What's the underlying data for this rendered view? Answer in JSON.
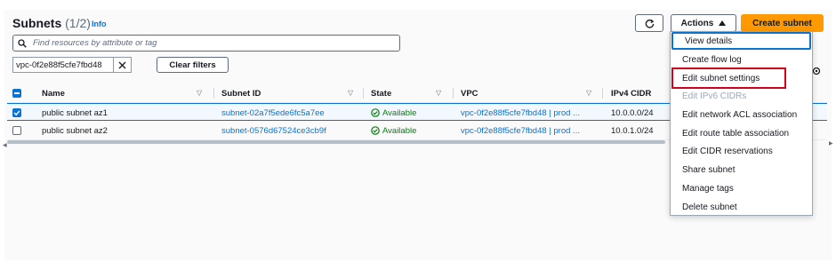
{
  "header": {
    "title": "Subnets",
    "count": "(1/2)",
    "info": "Info",
    "actions_label": "Actions",
    "create_label": "Create subnet"
  },
  "search": {
    "placeholder": "Find resources by attribute or tag",
    "value": ""
  },
  "filter": {
    "token": "vpc-0f2e88f5cfe7fbd48",
    "clear_label": "Clear filters"
  },
  "table": {
    "columns": [
      "Name",
      "Subnet ID",
      "State",
      "VPC",
      "IPv4 CIDR"
    ],
    "rows": [
      {
        "selected": true,
        "name": "public subnet az1",
        "subnet_id": "subnet-02a7f5ede6fc5a7ee",
        "state": "Available",
        "vpc": "vpc-0f2e88f5cfe7fbd48 | prod ...",
        "cidr": "10.0.0.0/24"
      },
      {
        "selected": false,
        "name": "public subnet az2",
        "subnet_id": "subnet-0576d67524ce3cb9f",
        "state": "Available",
        "vpc": "vpc-0f2e88f5cfe7fbd48 | prod ...",
        "cidr": "10.0.1.0/24"
      }
    ]
  },
  "menu": {
    "items": [
      {
        "label": "View details",
        "disabled": false,
        "focused": true
      },
      {
        "label": "Create flow log",
        "disabled": false
      },
      {
        "label": "Edit subnet settings",
        "disabled": false,
        "highlighted": true
      },
      {
        "label": "Edit IPv6 CIDRs",
        "disabled": true
      },
      {
        "label": "Edit network ACL association",
        "disabled": false
      },
      {
        "label": "Edit route table association",
        "disabled": false
      },
      {
        "label": "Edit CIDR reservations",
        "disabled": false
      },
      {
        "label": "Share subnet",
        "disabled": false
      },
      {
        "label": "Manage tags",
        "disabled": false
      },
      {
        "label": "Delete subnet",
        "disabled": false
      }
    ]
  },
  "colors": {
    "accent": "#0972d3",
    "primary_button": "#ff9900",
    "success": "#037f0c",
    "highlight_box": "#d0021b"
  },
  "icons": [
    "search-icon",
    "refresh-icon",
    "caret-up-icon",
    "close-icon",
    "settings-icon",
    "sort-icon",
    "status-ok-icon",
    "checkbox-icon"
  ]
}
